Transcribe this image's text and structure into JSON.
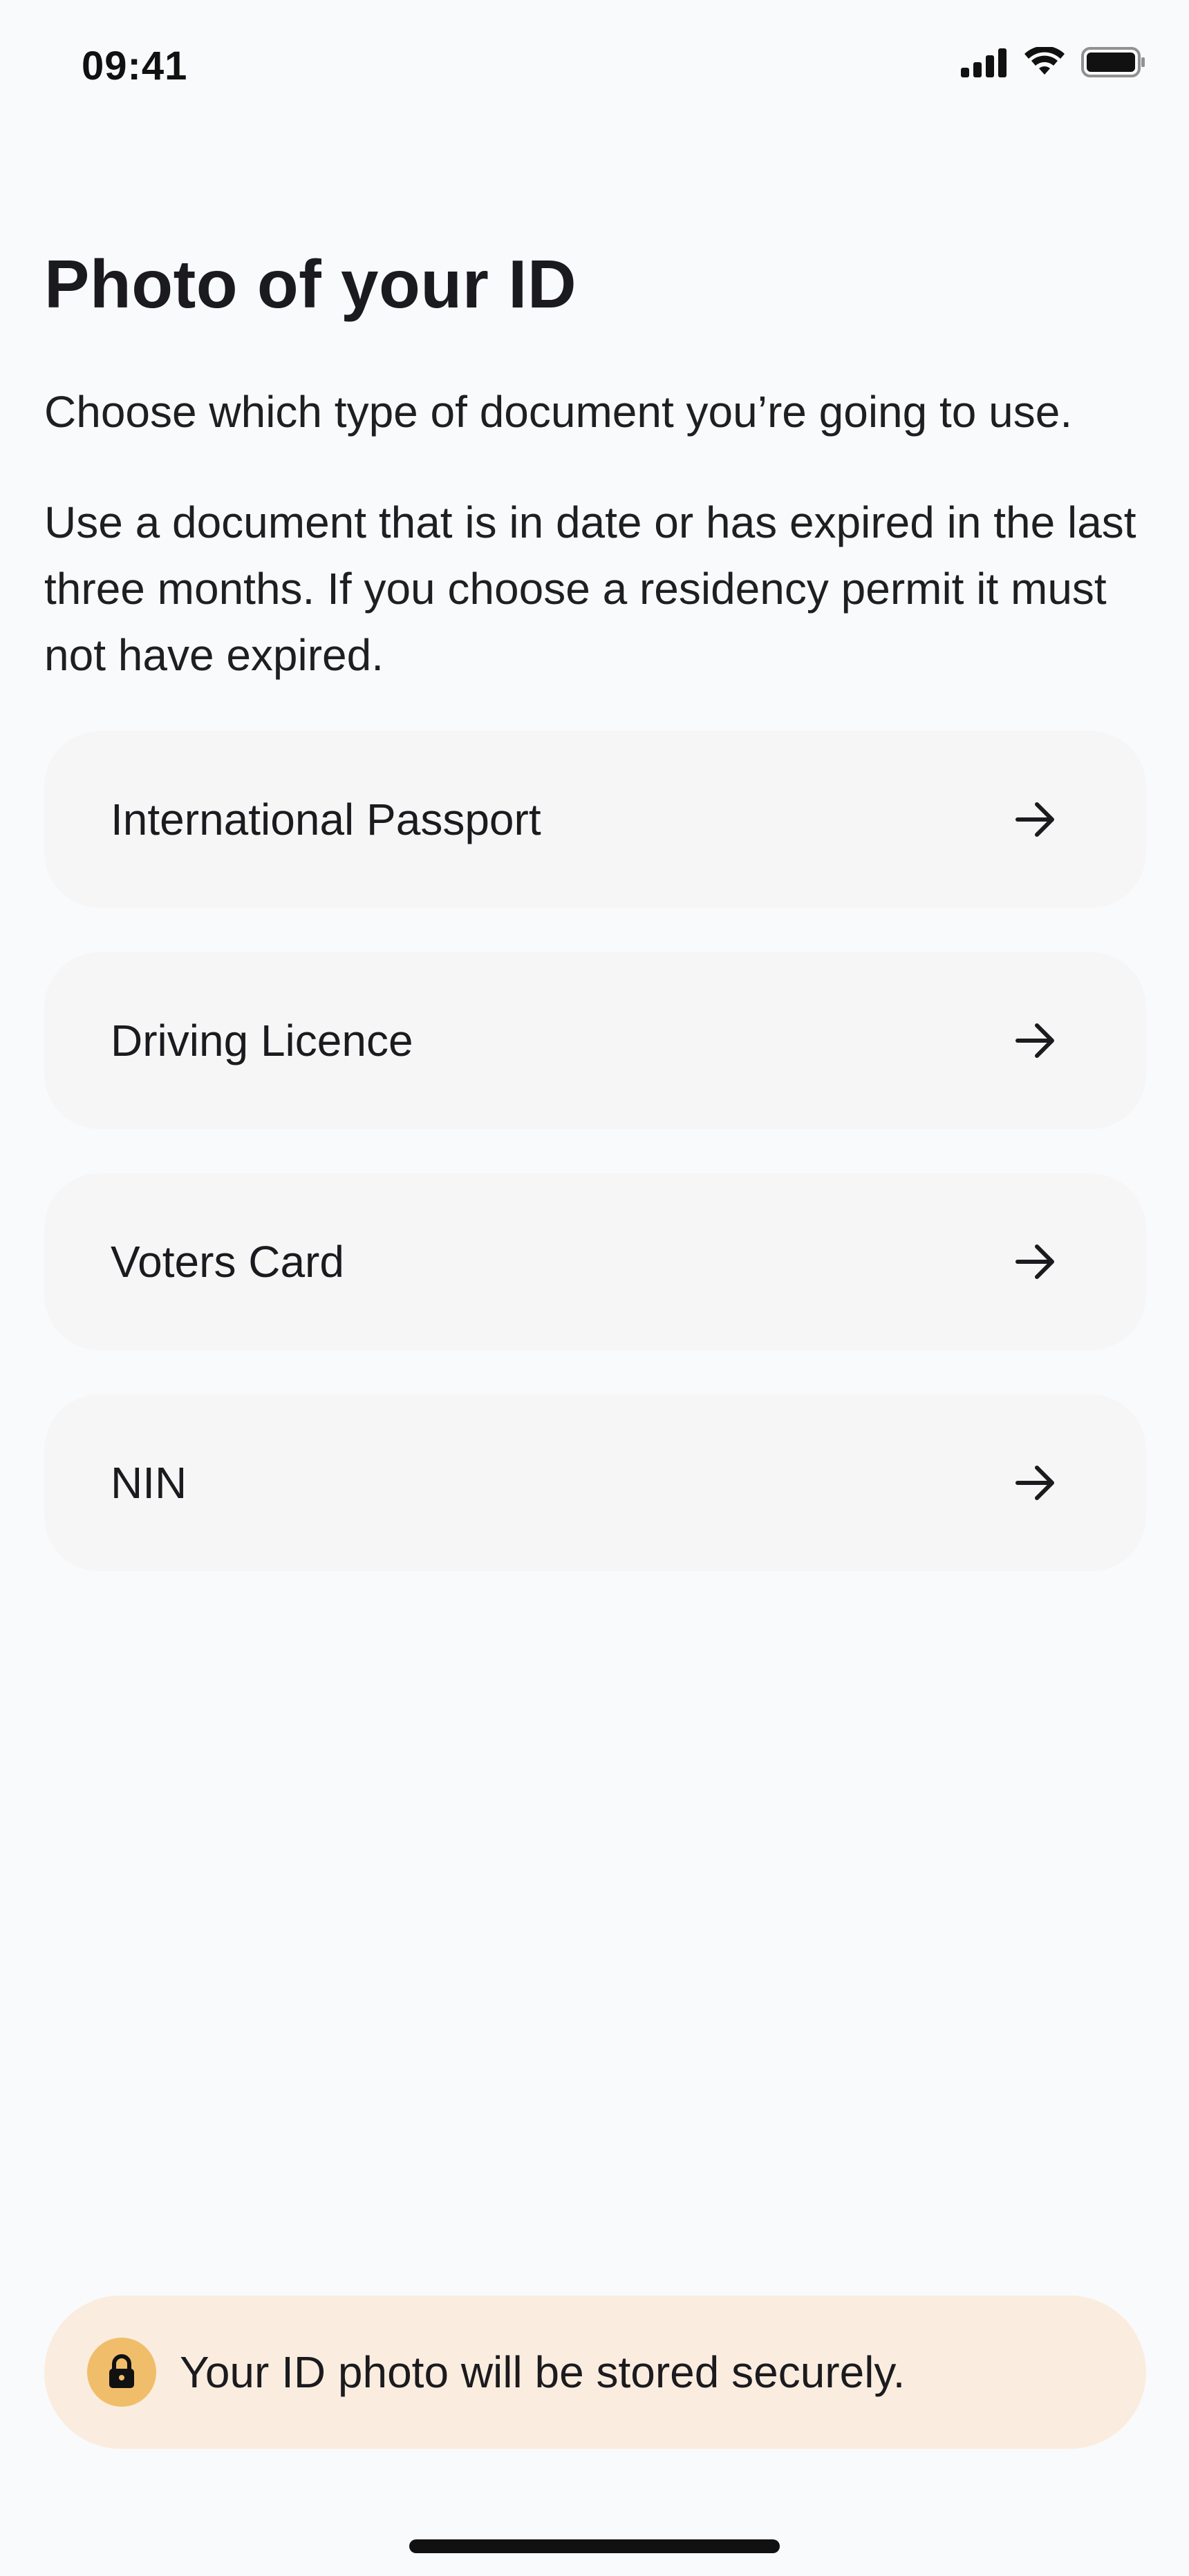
{
  "status_bar": {
    "time": "09:41",
    "icons": [
      "cellular-signal-icon",
      "wifi-icon",
      "battery-icon"
    ]
  },
  "header": {
    "title": "Photo of your ID",
    "subtitle": "Choose which type of document you’re going to use."
  },
  "description": "Use a document that is in date or has expired in the last three months. If you choose a residency permit it must not have expired.",
  "options": [
    {
      "label": "International Passport",
      "icon": "arrow-right-icon"
    },
    {
      "label": "Driving Licence",
      "icon": "arrow-right-icon"
    },
    {
      "label": "Voters Card",
      "icon": "arrow-right-icon"
    },
    {
      "label": "NIN",
      "icon": "arrow-right-icon"
    }
  ],
  "security_banner": {
    "icon": "lock-icon",
    "text": "Your ID photo will be stored securely."
  },
  "colors": {
    "background": "#F9FAFC",
    "option_background": "#F6F6F6",
    "banner_background": "#FAEDDF",
    "lock_badge": "#F0BE6B",
    "text": "#1B1B1F"
  }
}
